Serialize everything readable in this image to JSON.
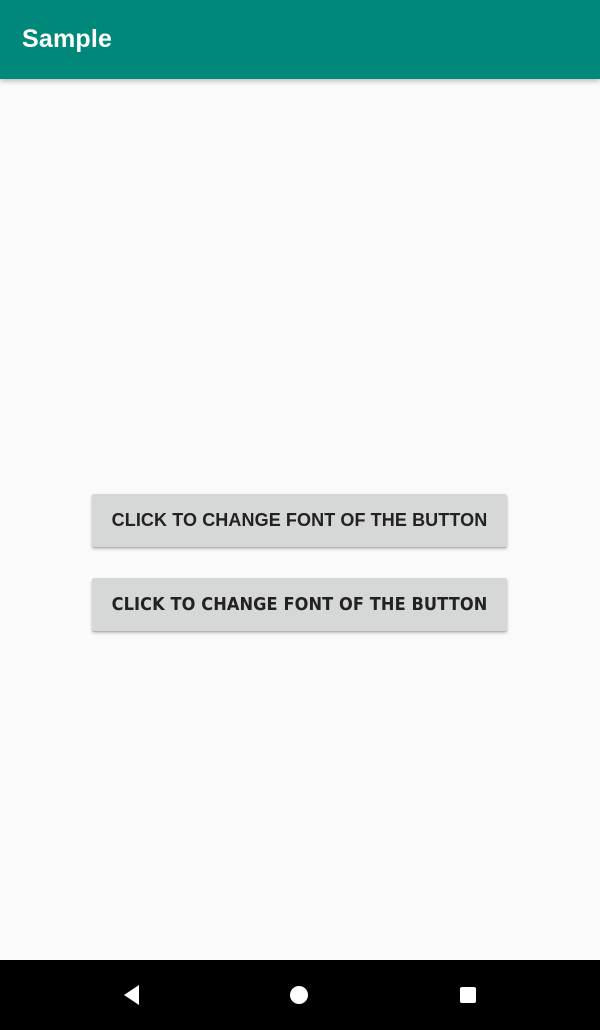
{
  "app": {
    "title": "Sample",
    "appbar_color": "#00897B",
    "background_color": "#FAFAFA"
  },
  "main": {
    "buttons": [
      {
        "label": "Click to change font of the button",
        "name": "change-font-button-primary",
        "fill_color": "#D6D7D7",
        "text_color": "#222222"
      },
      {
        "label": "Click to change font of the button",
        "name": "change-font-button-secondary",
        "fill_color": "#D6D7D7",
        "text_color": "#222222"
      }
    ]
  },
  "navbar": {
    "background_color": "#000000",
    "items": [
      {
        "icon": "back-triangle-icon",
        "label": "Back"
      },
      {
        "icon": "home-circle-icon",
        "label": "Home"
      },
      {
        "icon": "recents-square-icon",
        "label": "Recents"
      }
    ]
  }
}
